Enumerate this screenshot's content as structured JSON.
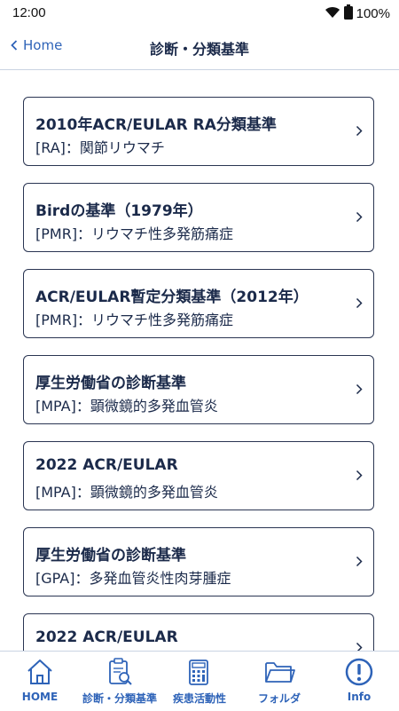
{
  "status_bar": {
    "time": "12:00",
    "battery": "100%"
  },
  "nav": {
    "back_label": "Home",
    "title": "診断・分類基準"
  },
  "criteria": [
    {
      "title": "2010年ACR/EULAR RA分類基準",
      "subtitle": "[RA]：関節リウマチ"
    },
    {
      "title": "Birdの基準（1979年）",
      "subtitle": "[PMR]：リウマチ性多発筋痛症"
    },
    {
      "title": "ACR/EULAR暫定分類基準（2012年）",
      "subtitle": "[PMR]：リウマチ性多発筋痛症"
    },
    {
      "title": "厚生労働省の診断基準",
      "subtitle": "[MPA]：顕微鏡的多発血管炎"
    },
    {
      "title": "2022 ACR/EULAR",
      "subtitle": "[MPA]：顕微鏡的多発血管炎"
    },
    {
      "title": "厚生労働省の診断基準",
      "subtitle": "[GPA]：多発血管炎性肉芽腫症"
    },
    {
      "title": "2022 ACR/EULAR",
      "subtitle": ""
    }
  ],
  "tab_bar": {
    "tabs": [
      {
        "label": "HOME",
        "icon": "home-icon"
      },
      {
        "label": "診断・分類基準",
        "icon": "clipboard-search-icon"
      },
      {
        "label": "疾患活動性",
        "icon": "calculator-icon"
      },
      {
        "label": "フォルダ",
        "icon": "folder-icon"
      },
      {
        "label": "Info",
        "icon": "info-icon"
      }
    ]
  },
  "colors": {
    "accent": "#2e63b8",
    "text": "#1b2a4a",
    "card_border": "#2a3552",
    "divider": "#c9d3e2"
  }
}
